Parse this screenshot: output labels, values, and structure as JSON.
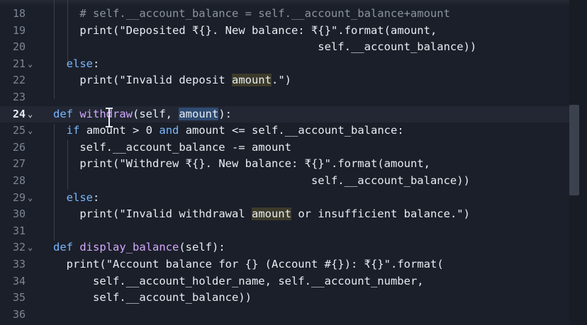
{
  "editor": {
    "lines": [
      {
        "no": "18",
        "fold": "",
        "text": "    # self.__account_balance = self.__account_balance+amount"
      },
      {
        "no": "19",
        "fold": "",
        "text": "    print(\"Deposited ₹{}. New balance: ₹{}\".format(amount,"
      },
      {
        "no": "20",
        "fold": "",
        "text": "                                        self.__account_balance))"
      },
      {
        "no": "21",
        "fold": "⌄",
        "text": "  else:"
      },
      {
        "no": "22",
        "fold": "",
        "text": "    print(\"Invalid deposit amount.\")"
      },
      {
        "no": "23",
        "fold": "",
        "text": ""
      },
      {
        "no": "24",
        "fold": "⌄",
        "text": "def withdraw(self, amount):"
      },
      {
        "no": "25",
        "fold": "⌄",
        "text": "  if amount > 0 and amount <= self.__account_balance:"
      },
      {
        "no": "26",
        "fold": "",
        "text": "    self.__account_balance -= amount"
      },
      {
        "no": "27",
        "fold": "",
        "text": "    print(\"Withdrew ₹{}. New balance: ₹{}\".format(amount,"
      },
      {
        "no": "28",
        "fold": "",
        "text": "                                       self.__account_balance))"
      },
      {
        "no": "29",
        "fold": "⌄",
        "text": "  else:"
      },
      {
        "no": "30",
        "fold": "",
        "text": "    print(\"Invalid withdrawal amount or insufficient balance.\")"
      },
      {
        "no": "31",
        "fold": "",
        "text": ""
      },
      {
        "no": "32",
        "fold": "⌄",
        "text": "def display_balance(self):"
      },
      {
        "no": "33",
        "fold": "",
        "text": "  print(\"Account balance for {} (Account #{}): ₹{}\".format("
      },
      {
        "no": "34",
        "fold": "",
        "text": "      self.__account_holder_name, self.__account_number,"
      },
      {
        "no": "35",
        "fold": "",
        "text": "      self.__account_balance))"
      },
      {
        "no": "36",
        "fold": "",
        "text": ""
      }
    ],
    "current_line": "24",
    "cursor_icon": "text-cursor-icon"
  }
}
